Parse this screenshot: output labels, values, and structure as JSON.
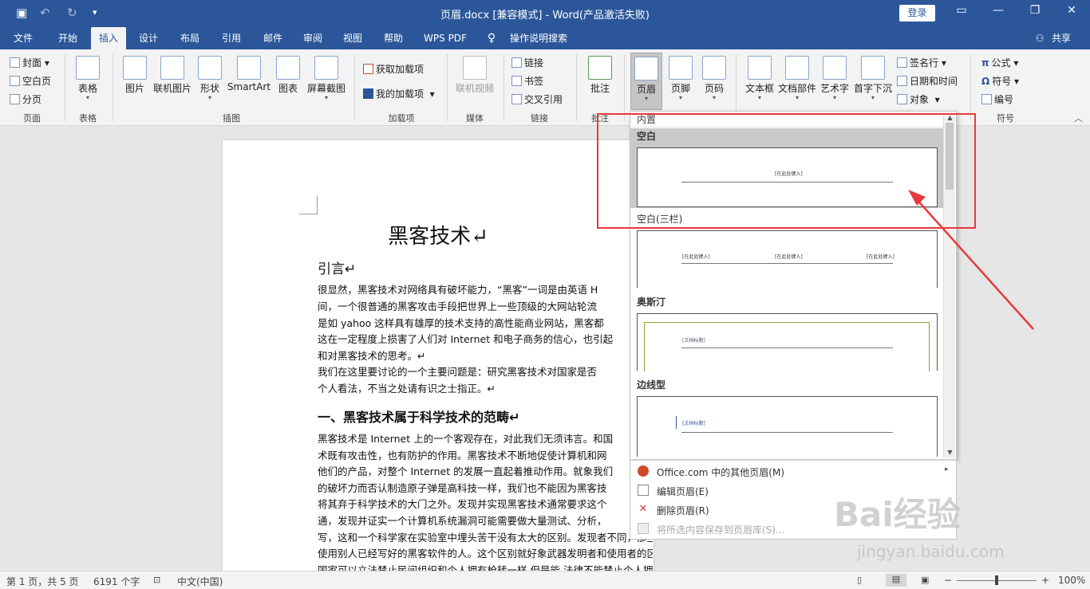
{
  "titlebar": {
    "title": "页眉.docx [兼容模式]  -  Word(产品激活失败)",
    "login": "登录",
    "save_icon": "save-icon",
    "undo_icon": "undo-icon",
    "redo_icon": "redo-icon"
  },
  "tabs": [
    "文件",
    "开始",
    "插入",
    "设计",
    "布局",
    "引用",
    "邮件",
    "审阅",
    "视图",
    "帮助",
    "WPS PDF"
  ],
  "tell_me": "操作说明搜索",
  "share": "共享",
  "ribbon": {
    "pages": {
      "cover": "封面",
      "blank": "空白页",
      "break": "分页",
      "group": "页面"
    },
    "tables": {
      "table": "表格",
      "group": "表格"
    },
    "illustrations": {
      "picture": "图片",
      "online_picture": "联机图片",
      "shapes": "形状",
      "smartart": "SmartArt",
      "chart": "图表",
      "screenshot": "屏幕截图",
      "group": "插图"
    },
    "addins": {
      "get": "获取加载项",
      "my": "我的加载项",
      "group": "加载项"
    },
    "media": {
      "online_video": "联机视频",
      "group": "媒体"
    },
    "links": {
      "link": "链接",
      "bookmark": "书签",
      "cross_ref": "交叉引用",
      "group": "链接"
    },
    "comments": {
      "comment": "批注",
      "group": "批注"
    },
    "header_footer": {
      "header": "页眉",
      "footer": "页脚",
      "page_number": "页码"
    },
    "text": {
      "textbox": "文本框",
      "quick_parts": "文档部件",
      "wordart": "艺术字",
      "dropcap": "首字下沉",
      "signature": "签名行",
      "datetime": "日期和时间",
      "object": "对象"
    },
    "symbols": {
      "equation": "公式",
      "symbol": "符号",
      "number": "编号",
      "group": "符号"
    }
  },
  "document": {
    "title": "黑客技术↵",
    "intro_heading": "引言↵",
    "paragraphs": [
      "很显然，黑客技术对网络具有破坏能力，“黑客”一词是由英语 H",
      "间，一个很普通的黑客攻击手段把世界上一些顶级的大网站轮流",
      "是如 yahoo 这样具有雄厚的技术支持的高性能商业网站，黑客都",
      "这在一定程度上损害了人们对 Internet 和电子商务的信心，也引起",
      "和对黑客技术的思考。↵",
      "我们在这里要讨论的一个主要问题是：研究黑客技术对国家是否",
      "个人看法，不当之处请有识之士指正。↵"
    ],
    "section1_heading": "一、黑客技术属于科学技术的范畴↵",
    "section1_paragraphs": [
      "黑客技术是 Internet 上的一个客观存在，对此我们无须讳言。和国",
      "术既有攻击性，也有防护的作用。黑客技术不断地促使计算机和网",
      "他们的产品，对整个 Internet 的发展一直起着推动作用。就象我们",
      "的破坏力而否认制造原子弹是高科技一样，我们也不能因为黑客技",
      "将其弃于科学技术的大门之外。发现并实现黑客技术通常要求这个",
      "通，发现并证实一个计算机系统漏洞可能需要做大量测试、分析，",
      "写，这和一个科学家在实验室中埋头苦干没有太大的区别。发现者不同，那些在网上寻找并",
      "使用别人已经写好的黑客软件的人。这个区别就好象武器发明者和使用者的区别。不象一个",
      "国家可以立法禁止民间组织和个人拥有枪转一样 但是能 法律不能禁止个人拥有黑客技术 ↵"
    ]
  },
  "gallery": {
    "category": "内置",
    "items": [
      {
        "name": "空白",
        "placeholders": [
          "[在此处键入]"
        ]
      },
      {
        "name": "空白(三栏)",
        "placeholders": [
          "[在此处键入]",
          "[在此处键入]",
          "[在此处键入]"
        ]
      },
      {
        "name": "奥斯汀",
        "placeholders": [
          "[文档标题]"
        ]
      },
      {
        "name": "边线型",
        "placeholders": [
          "[文档标题]"
        ]
      }
    ]
  },
  "menu": {
    "more": "Office.com 中的其他页眉(M)",
    "edit": "编辑页眉(E)",
    "remove": "删除页眉(R)",
    "save": "将所选内容保存到页眉库(S)..."
  },
  "statusbar": {
    "page": "第 1 页，共 5 页",
    "words": "6191 个字",
    "language": "中文(中国)",
    "zoom": "100%",
    "zoom_out": "−",
    "zoom_in": "+"
  },
  "watermark": {
    "brand": "Bai经验",
    "url": "jingyan.baidu.com"
  },
  "colors": {
    "accent": "#2b579a",
    "highlight": "#e8393c"
  }
}
